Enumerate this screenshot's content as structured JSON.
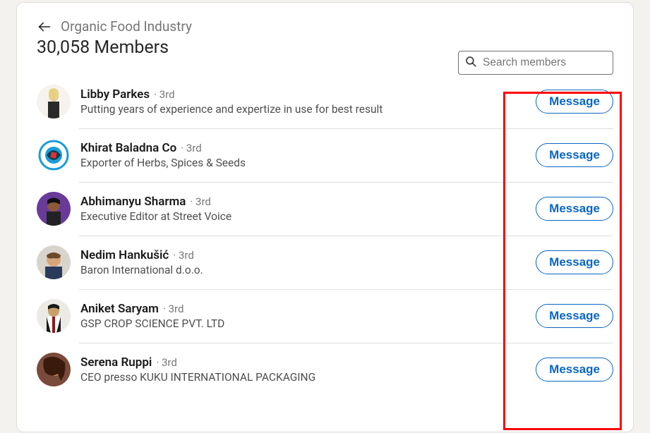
{
  "header": {
    "group_name": "Organic Food Industry",
    "member_count": "30,058 Members"
  },
  "search": {
    "placeholder": "Search members"
  },
  "message_label": "Message",
  "members": [
    {
      "name": "Libby Parkes",
      "degree": "3rd",
      "headline": "Putting years of experience and expertize in use for best result"
    },
    {
      "name": "Khirat Baladna Co",
      "degree": "3rd",
      "headline": "Exporter of Herbs, Spices & Seeds"
    },
    {
      "name": "Abhimanyu Sharma",
      "degree": "3rd",
      "headline": "Executive Editor at Street Voice"
    },
    {
      "name": "Nedim Hankušić",
      "degree": "3rd",
      "headline": "Baron International d.o.o."
    },
    {
      "name": "Aniket Saryam",
      "degree": "3rd",
      "headline": "GSP CROP SCIENCE PVT. LTD"
    },
    {
      "name": "Serena Ruppi",
      "degree": "3rd",
      "headline": "CEO presso KUKU INTERNATIONAL PACKAGING"
    }
  ]
}
